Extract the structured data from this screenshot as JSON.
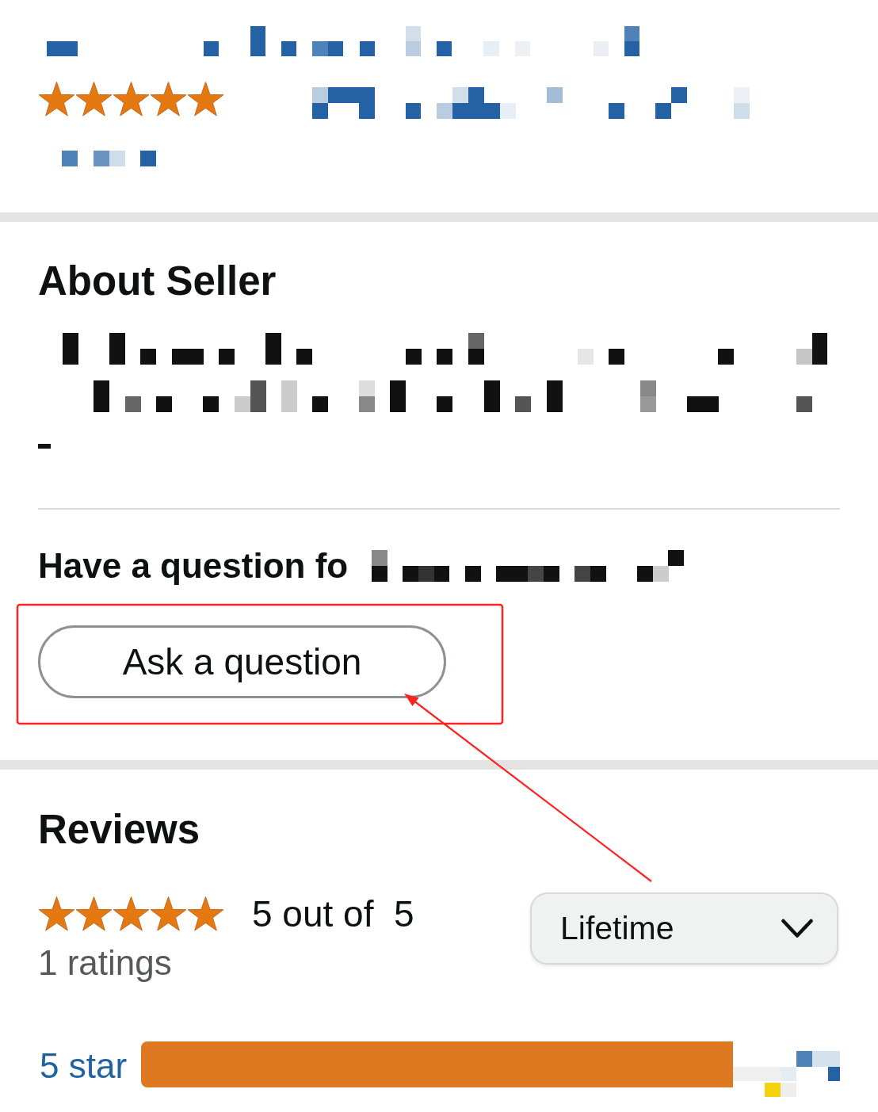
{
  "seller_summary": {
    "stars": 5
  },
  "about_seller": {
    "title": "About Seller"
  },
  "question": {
    "prompt": "Have a question fo",
    "button": "Ask a question"
  },
  "reviews": {
    "title": "Reviews",
    "stars": 5,
    "average": "5 out of  5",
    "count": "1 ratings",
    "period_select": {
      "value": "Lifetime"
    },
    "histogram": [
      {
        "label": "5 star",
        "level": 1
      }
    ]
  }
}
